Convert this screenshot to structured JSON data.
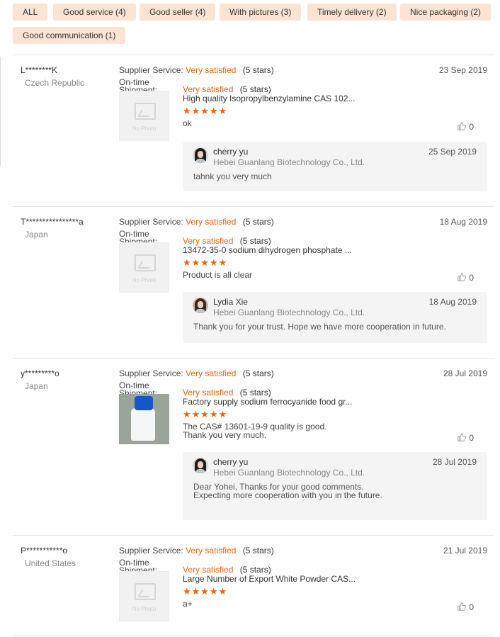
{
  "filters": [
    "ALL",
    "Good service (4)",
    "Good seller (4)",
    "With pictures (3)",
    "Timely delivery (2)",
    "Nice packaging (2)",
    "Good communication (1)"
  ],
  "common": {
    "supplier_label": "Supplier Service:",
    "ontime_label": "On-time",
    "shipment_label": "Shipment:",
    "satisfied": "Very satisfied",
    "five_stars": "(5 stars)",
    "star_glyphs": "★★★★★",
    "no_photo": "No Photo"
  },
  "reviews": [
    {
      "user": "L********K",
      "country": "Czech Republic",
      "date": "23 Sep 2019",
      "product": "High quality Isopropylbenzylamine CAS 102...",
      "comment": [
        "ok"
      ],
      "likes": "0",
      "has_photo": false,
      "reply": {
        "name": "cherry yu",
        "company": "Hebei Guanlang Biotechnology Co., Ltd.",
        "date": "25 Sep 2019",
        "text": [
          "tahnk you very much"
        ]
      }
    },
    {
      "user": "T****************a",
      "country": "Japan",
      "date": "18 Aug 2019",
      "product": "13472-35-0 sodium dihydrogen phosphate ...",
      "comment": [
        "Product is all clear"
      ],
      "likes": "0",
      "has_photo": false,
      "reply": {
        "name": "Lydia Xie",
        "company": "Hebei Guanlang Biotechnology Co., Ltd.",
        "date": "18 Aug 2019",
        "text": [
          "Thank you for your trust. Hope we have more cooperation in future."
        ]
      }
    },
    {
      "user": "y*********o",
      "country": "Japan",
      "date": "28 Jul 2019",
      "product": "Factory supply sodium ferrocyanide food gr...",
      "comment": [
        "The CAS# 13601-19-9 quality is good.",
        "Thank you very much."
      ],
      "likes": "0",
      "has_photo": true,
      "reply": {
        "name": "cherry yu",
        "company": "Hebei Guanlang Biotechnology Co., Ltd.",
        "date": "28 Jul 2019",
        "text": [
          "Dear Yohei, Thanks for your good comments.",
          "Expecting more cooperation with you in the future."
        ]
      }
    },
    {
      "user": "P***********o",
      "country": "United States",
      "date": "21 Jul 2019",
      "product": "Large Number of Export White Powder CAS...",
      "comment": [
        "a+"
      ],
      "likes": "0",
      "has_photo": false
    }
  ]
}
